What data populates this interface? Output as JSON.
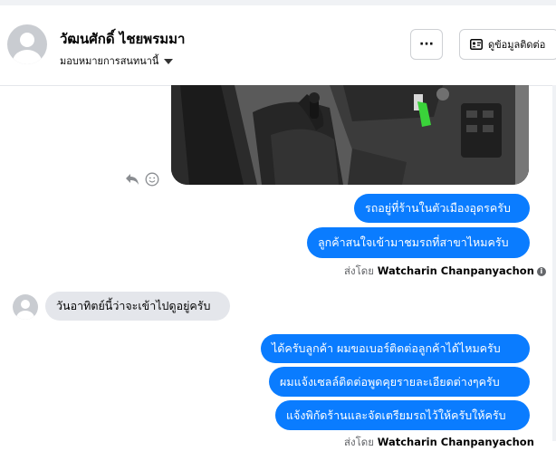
{
  "header": {
    "contact_name": "วัฒนศักดิ์ ไชยพรมมา",
    "assign_label": "มอบหมายการสนทนานี้",
    "more_label": "···",
    "contact_info_label": "ดูข้อมูลติดต่อ"
  },
  "messages": {
    "out1": "รถอยู่ที่ร้านในตัวเมืองอุดรครับ",
    "out2": "ลูกค้าสนใจเข้ามาชมรถที่สาขาไหมครับ",
    "sent_by_label": "ส่งโดย",
    "sent_by_name": "Watcharin Chanpanyachon",
    "in1": "วันอาทิตย์นี้ว่าจะเข้าไปดูอยู่ครับ",
    "out3": "ได้ครับลูกค้า ผมขอเบอร์ติดต่อลูกค้าได้ไหมครับ",
    "out4": "ผมแจ้งเซลล์ติดต่อพูดคุยรายละเอียดต่างๆครับ",
    "out5": "แจ้งพิกัดร้านและจัดเตรียมรถไว้ให้ครับให้ครับ",
    "sent_by_label_2": "ส่งโดย",
    "sent_by_name_2": "Watcharin Chanpanyachon"
  },
  "icons": {
    "reply": "reply-icon",
    "react": "smiley-icon",
    "info": "info-icon",
    "id_card": "id-card-icon"
  },
  "colors": {
    "outgoing_bubble": "#0a7cff",
    "incoming_bubble": "#e4e6eb",
    "secondary_text": "#65676b"
  }
}
